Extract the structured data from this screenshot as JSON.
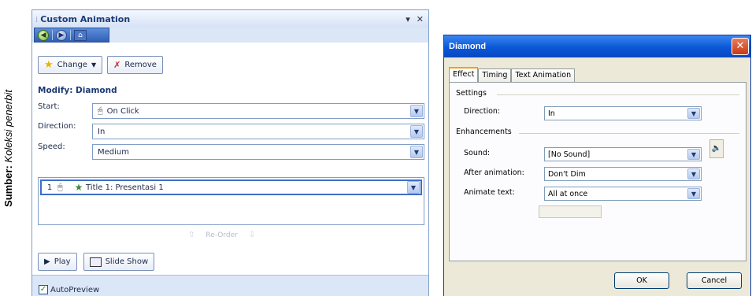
{
  "caption": {
    "bold": "Sumber:",
    "italic": "Koleksi penerbit"
  },
  "pane": {
    "title": "Custom Animation",
    "controls": {
      "dropdown": "▾",
      "close": "✕"
    },
    "change_label": "Change",
    "remove_label": "Remove",
    "modify_title": "Modify: Diamond",
    "start_label": "Start:",
    "start_value": "On Click",
    "direction_label": "Direction:",
    "direction_value": "In",
    "speed_label": "Speed:",
    "speed_value": "Medium",
    "list_items": [
      {
        "number": "1",
        "label": "Title 1: Presentasi 1"
      }
    ],
    "reorder_label": "Re-Order",
    "play_label": "Play",
    "slideshow_label": "Slide Show",
    "autopreview_label": "AutoPreview",
    "autopreview_checked": true
  },
  "dialog": {
    "title": "Diamond",
    "tabs": [
      "Effect",
      "Timing",
      "Text Animation"
    ],
    "active_tab": "Effect",
    "settings_label": "Settings",
    "direction_label": "Direction:",
    "direction_value": "In",
    "enhancements_label": "Enhancements",
    "sound_label": "Sound:",
    "sound_value": "[No Sound]",
    "after_label": "After animation:",
    "after_value": "Don't Dim",
    "animate_text_label": "Animate text:",
    "animate_text_value": "All at once",
    "ok_label": "OK",
    "cancel_label": "Cancel"
  },
  "colors": {
    "pane_bg": "#dbe6f7",
    "pane_title": "#1c3a75",
    "dialog_title_bar": "#0a57d8",
    "dialog_bg": "#ece9d8",
    "close_button": "#c73b16",
    "active_tab_accent": "#f6a000"
  }
}
